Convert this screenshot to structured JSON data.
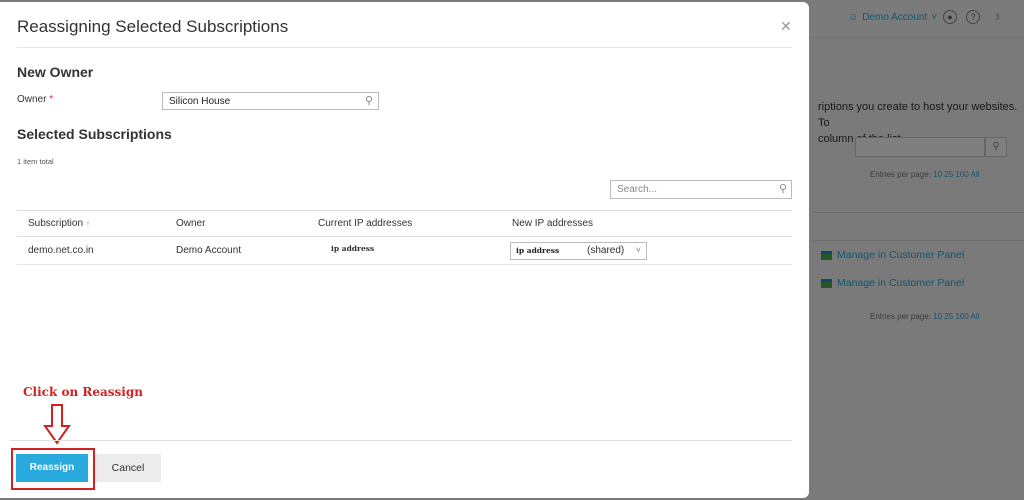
{
  "background": {
    "account_label": "Demo Account",
    "text_line1": "riptions you create to host your websites. To",
    "text_line2": "column of the list.",
    "entries_label": "Entries per page:",
    "entries_options": "10 25 100 All",
    "manage_label": "Manage in Customer Panel"
  },
  "modal": {
    "title": "Reassigning Selected Subscriptions",
    "new_owner_heading": "New Owner",
    "owner_label": "Owner",
    "owner_required_mark": "*",
    "owner_value": "Silicon House",
    "selected_heading": "Selected Subscriptions",
    "item_count": "1 item total",
    "search_placeholder": "Search...",
    "table": {
      "columns": [
        "Subscription",
        "Owner",
        "Current IP addresses",
        "New IP addresses"
      ],
      "sort_indicator": "↑",
      "rows": [
        {
          "subscription": "demo.net.co.in",
          "owner": "Demo Account",
          "current_ip": "ip address",
          "new_ip": "ip address",
          "new_ip_type": "(shared)"
        }
      ]
    },
    "annotation": "Click on Reassign",
    "reassign_label": "Reassign",
    "cancel_label": "Cancel"
  },
  "colors": {
    "primary": "#28aade",
    "annotation": "#d32020",
    "required": "#d02d4c"
  }
}
